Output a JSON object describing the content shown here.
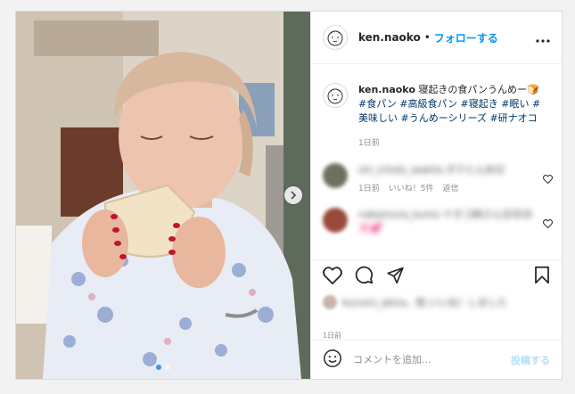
{
  "header": {
    "username": "ken.naoko",
    "separator": "•",
    "follow_label": "フォローする",
    "more_icon": "more-icon"
  },
  "caption": {
    "username": "ken.naoko",
    "text": "寝起きの食パンうんめー🍞",
    "hashtags": "#食パン #高級食パン #寝起き #眠い #美味しい #うんめーシリーズ #研ナオコ",
    "time": "1日前"
  },
  "comments": [
    {
      "text_blurred": "shi_ichido_wakila ボクとんめ😊",
      "time": "1日前",
      "likes": "いいね！5件",
      "reply": "返信",
      "avatar_color": "#6f6f5f"
    },
    {
      "text_blurred": "nakamura_kumo ナオコ姉さん😍😍😍🌸💕",
      "avatar_color": "#9a4a3a"
    }
  ],
  "likes_blurred": "kurumi_akira、他  いいね！しました",
  "post_time": "1日前",
  "add_comment": {
    "placeholder": "コメントを追加...",
    "post_label": "投稿する"
  },
  "colors": {
    "accent": "#0095f6",
    "post_disabled": "#b2dffc",
    "hashtag": "#00376b"
  }
}
